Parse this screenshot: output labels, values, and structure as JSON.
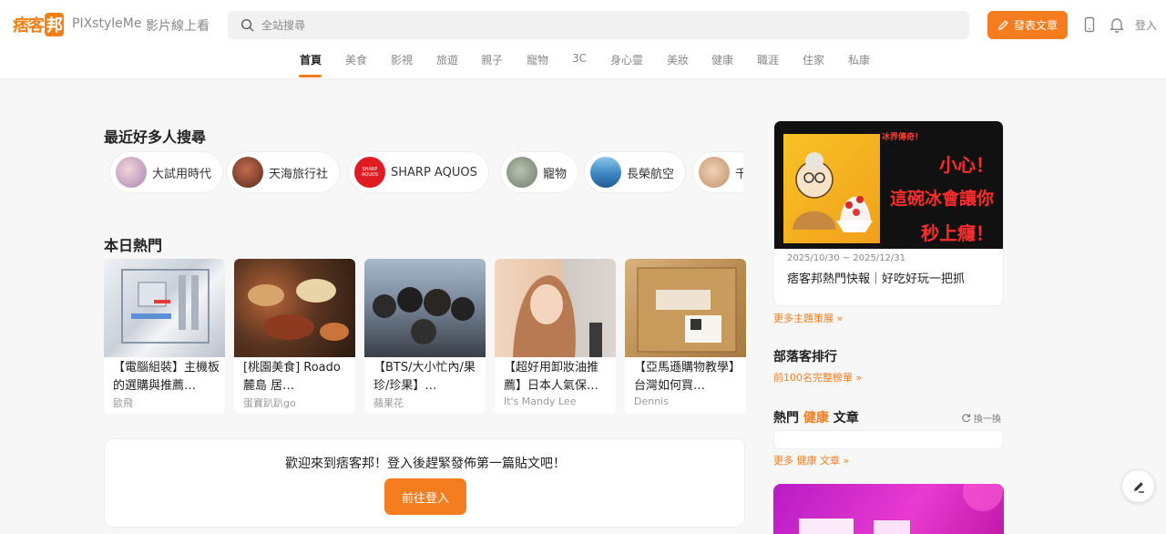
{
  "header": {
    "logo_text": "痞客",
    "logo_box": "邦",
    "links": [
      "PIXstyleMe",
      "影片線上看"
    ],
    "search_placeholder": "全站搜尋",
    "post_button": "發表文章",
    "login": "登入"
  },
  "tabs": [
    "首頁",
    "美食",
    "影視",
    "旅遊",
    "親子",
    "寵物",
    "3C",
    "身心靈",
    "美妝",
    "健康",
    "職涯",
    "住家",
    "私康"
  ],
  "active_tab": "首頁",
  "trending": {
    "title": "最近好多人搜尋",
    "chips": [
      {
        "label": "大試用時代",
        "avatar_color": "#b79ac2"
      },
      {
        "label": "天海旅行社",
        "avatar_color": "#7a3b2a"
      },
      {
        "label": "SHARP AQUOS",
        "avatar_color": "#e11b22",
        "avatar_text": "SHARP AQUOS"
      },
      {
        "label": "寵物",
        "avatar_color": "#8f9c8a"
      },
      {
        "label": "長榮航空",
        "avatar_color": "#3b7fb8"
      },
      {
        "label": "千",
        "avatar_color": "#d6a47f"
      }
    ]
  },
  "hot": {
    "title": "本日熱門",
    "cards": [
      {
        "title": "【電腦組裝】主機板的選購與推薦…",
        "author": "歐飛",
        "thumb": "#d8dde4"
      },
      {
        "title": "[桃園美食] Roado 麓島 居…",
        "author": "蛋寶趴趴go",
        "thumb": "#4a3322"
      },
      {
        "title": "【BTS/大小忙內/果珍/珍果】…",
        "author": "蘋果花",
        "thumb": "#6f7d8e"
      },
      {
        "title": "【超好用卸妝油推薦】日本人氣保…",
        "author": "It's Mandy Lee",
        "thumb": "#e8c7a9"
      },
      {
        "title": "【亞馬遜購物教學】台灣如何買…",
        "author": "Dennis",
        "thumb": "#c39a62"
      }
    ]
  },
  "welcome": {
    "message": "歡迎來到痞客邦！登入後趕緊發佈第一篇貼文吧！",
    "button": "前往登入"
  },
  "sidebar": {
    "banner": {
      "badge": "冰界傳奇！",
      "lines": [
        "小心！",
        "這碗冰會讓你",
        "秒上癮！"
      ],
      "date": "2025/10/30 ~ 2025/12/31",
      "title": "痞客邦熱門快報｜好吃好玩一把抓"
    },
    "more_topics": "更多主題策展",
    "ranking_title": "部落客排行",
    "ranking_link": "前100名完整榜單",
    "hot_articles": {
      "prefix": "熱門",
      "category": "健康",
      "suffix": "文章",
      "refresh": "換一換",
      "more_prefix": "更多",
      "more_suffix": "文章"
    }
  },
  "colors": {
    "accent": "#f57d1f",
    "page_bg": "#f7f7f7"
  }
}
